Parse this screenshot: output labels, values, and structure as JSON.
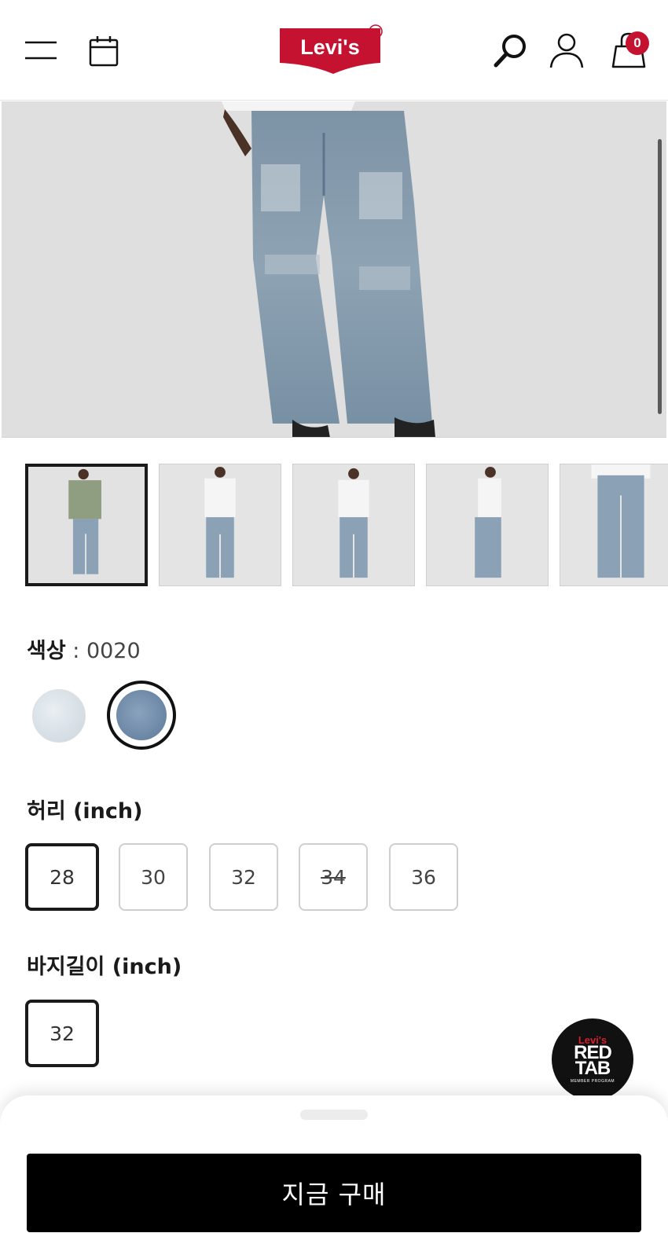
{
  "header": {
    "brand": "Levi's",
    "cart_count": "0"
  },
  "icons": {
    "menu": "hamburger-menu-icon",
    "calendar": "calendar-icon",
    "search": "search-icon",
    "account": "account-icon",
    "cart": "shopping-bag-icon"
  },
  "gallery": {
    "thumbnail_count": 5,
    "selected_index": 0
  },
  "color": {
    "label": "색상",
    "separator": " : ",
    "value": "0020",
    "swatches": [
      {
        "name": "light-wash",
        "color": "#d6dee5",
        "selected": false
      },
      {
        "name": "medium-wash",
        "color": "#7891ad",
        "selected": true
      }
    ]
  },
  "waist": {
    "label": "허리",
    "unit": " (inch)",
    "options": [
      {
        "value": "28",
        "selected": true,
        "available": true
      },
      {
        "value": "30",
        "selected": false,
        "available": true
      },
      {
        "value": "32",
        "selected": false,
        "available": true
      },
      {
        "value": "34",
        "selected": false,
        "available": false
      },
      {
        "value": "36",
        "selected": false,
        "available": true
      }
    ]
  },
  "length": {
    "label": "바지길이",
    "unit": " (inch)",
    "options": [
      {
        "value": "32",
        "selected": true,
        "available": true
      }
    ]
  },
  "redtab": {
    "brand": "Levi's",
    "line1": "RED",
    "line2": "TAB",
    "sub": "MEMBER PROGRAM"
  },
  "cta": {
    "buy_label": "지금 구매"
  },
  "colors": {
    "brand_red": "#c41230",
    "button_black": "#000000",
    "selected_border": "#1a1a1a"
  }
}
